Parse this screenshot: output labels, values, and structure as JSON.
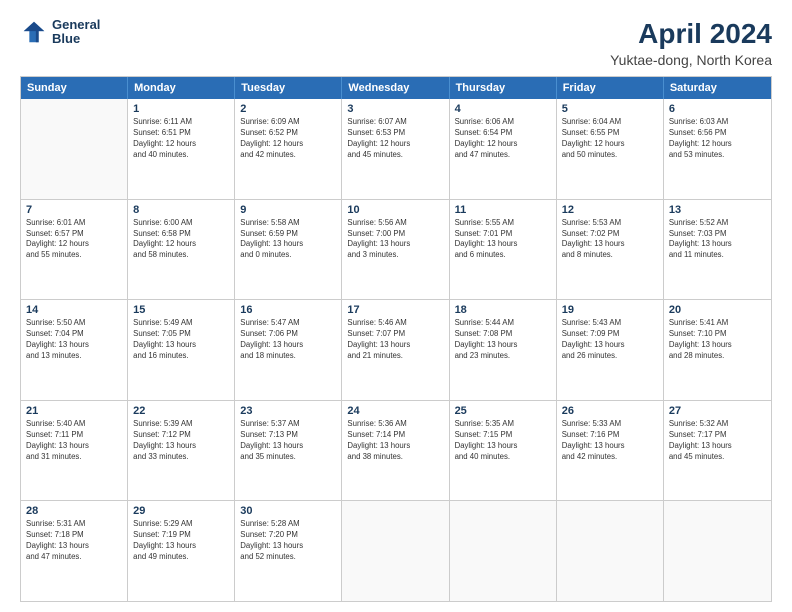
{
  "logo": {
    "line1": "General",
    "line2": "Blue"
  },
  "title": "April 2024",
  "subtitle": "Yuktae-dong, North Korea",
  "header_days": [
    "Sunday",
    "Monday",
    "Tuesday",
    "Wednesday",
    "Thursday",
    "Friday",
    "Saturday"
  ],
  "weeks": [
    [
      {
        "day": "",
        "info": ""
      },
      {
        "day": "1",
        "info": "Sunrise: 6:11 AM\nSunset: 6:51 PM\nDaylight: 12 hours\nand 40 minutes."
      },
      {
        "day": "2",
        "info": "Sunrise: 6:09 AM\nSunset: 6:52 PM\nDaylight: 12 hours\nand 42 minutes."
      },
      {
        "day": "3",
        "info": "Sunrise: 6:07 AM\nSunset: 6:53 PM\nDaylight: 12 hours\nand 45 minutes."
      },
      {
        "day": "4",
        "info": "Sunrise: 6:06 AM\nSunset: 6:54 PM\nDaylight: 12 hours\nand 47 minutes."
      },
      {
        "day": "5",
        "info": "Sunrise: 6:04 AM\nSunset: 6:55 PM\nDaylight: 12 hours\nand 50 minutes."
      },
      {
        "day": "6",
        "info": "Sunrise: 6:03 AM\nSunset: 6:56 PM\nDaylight: 12 hours\nand 53 minutes."
      }
    ],
    [
      {
        "day": "7",
        "info": "Sunrise: 6:01 AM\nSunset: 6:57 PM\nDaylight: 12 hours\nand 55 minutes."
      },
      {
        "day": "8",
        "info": "Sunrise: 6:00 AM\nSunset: 6:58 PM\nDaylight: 12 hours\nand 58 minutes."
      },
      {
        "day": "9",
        "info": "Sunrise: 5:58 AM\nSunset: 6:59 PM\nDaylight: 13 hours\nand 0 minutes."
      },
      {
        "day": "10",
        "info": "Sunrise: 5:56 AM\nSunset: 7:00 PM\nDaylight: 13 hours\nand 3 minutes."
      },
      {
        "day": "11",
        "info": "Sunrise: 5:55 AM\nSunset: 7:01 PM\nDaylight: 13 hours\nand 6 minutes."
      },
      {
        "day": "12",
        "info": "Sunrise: 5:53 AM\nSunset: 7:02 PM\nDaylight: 13 hours\nand 8 minutes."
      },
      {
        "day": "13",
        "info": "Sunrise: 5:52 AM\nSunset: 7:03 PM\nDaylight: 13 hours\nand 11 minutes."
      }
    ],
    [
      {
        "day": "14",
        "info": "Sunrise: 5:50 AM\nSunset: 7:04 PM\nDaylight: 13 hours\nand 13 minutes."
      },
      {
        "day": "15",
        "info": "Sunrise: 5:49 AM\nSunset: 7:05 PM\nDaylight: 13 hours\nand 16 minutes."
      },
      {
        "day": "16",
        "info": "Sunrise: 5:47 AM\nSunset: 7:06 PM\nDaylight: 13 hours\nand 18 minutes."
      },
      {
        "day": "17",
        "info": "Sunrise: 5:46 AM\nSunset: 7:07 PM\nDaylight: 13 hours\nand 21 minutes."
      },
      {
        "day": "18",
        "info": "Sunrise: 5:44 AM\nSunset: 7:08 PM\nDaylight: 13 hours\nand 23 minutes."
      },
      {
        "day": "19",
        "info": "Sunrise: 5:43 AM\nSunset: 7:09 PM\nDaylight: 13 hours\nand 26 minutes."
      },
      {
        "day": "20",
        "info": "Sunrise: 5:41 AM\nSunset: 7:10 PM\nDaylight: 13 hours\nand 28 minutes."
      }
    ],
    [
      {
        "day": "21",
        "info": "Sunrise: 5:40 AM\nSunset: 7:11 PM\nDaylight: 13 hours\nand 31 minutes."
      },
      {
        "day": "22",
        "info": "Sunrise: 5:39 AM\nSunset: 7:12 PM\nDaylight: 13 hours\nand 33 minutes."
      },
      {
        "day": "23",
        "info": "Sunrise: 5:37 AM\nSunset: 7:13 PM\nDaylight: 13 hours\nand 35 minutes."
      },
      {
        "day": "24",
        "info": "Sunrise: 5:36 AM\nSunset: 7:14 PM\nDaylight: 13 hours\nand 38 minutes."
      },
      {
        "day": "25",
        "info": "Sunrise: 5:35 AM\nSunset: 7:15 PM\nDaylight: 13 hours\nand 40 minutes."
      },
      {
        "day": "26",
        "info": "Sunrise: 5:33 AM\nSunset: 7:16 PM\nDaylight: 13 hours\nand 42 minutes."
      },
      {
        "day": "27",
        "info": "Sunrise: 5:32 AM\nSunset: 7:17 PM\nDaylight: 13 hours\nand 45 minutes."
      }
    ],
    [
      {
        "day": "28",
        "info": "Sunrise: 5:31 AM\nSunset: 7:18 PM\nDaylight: 13 hours\nand 47 minutes."
      },
      {
        "day": "29",
        "info": "Sunrise: 5:29 AM\nSunset: 7:19 PM\nDaylight: 13 hours\nand 49 minutes."
      },
      {
        "day": "30",
        "info": "Sunrise: 5:28 AM\nSunset: 7:20 PM\nDaylight: 13 hours\nand 52 minutes."
      },
      {
        "day": "",
        "info": ""
      },
      {
        "day": "",
        "info": ""
      },
      {
        "day": "",
        "info": ""
      },
      {
        "day": "",
        "info": ""
      }
    ]
  ]
}
